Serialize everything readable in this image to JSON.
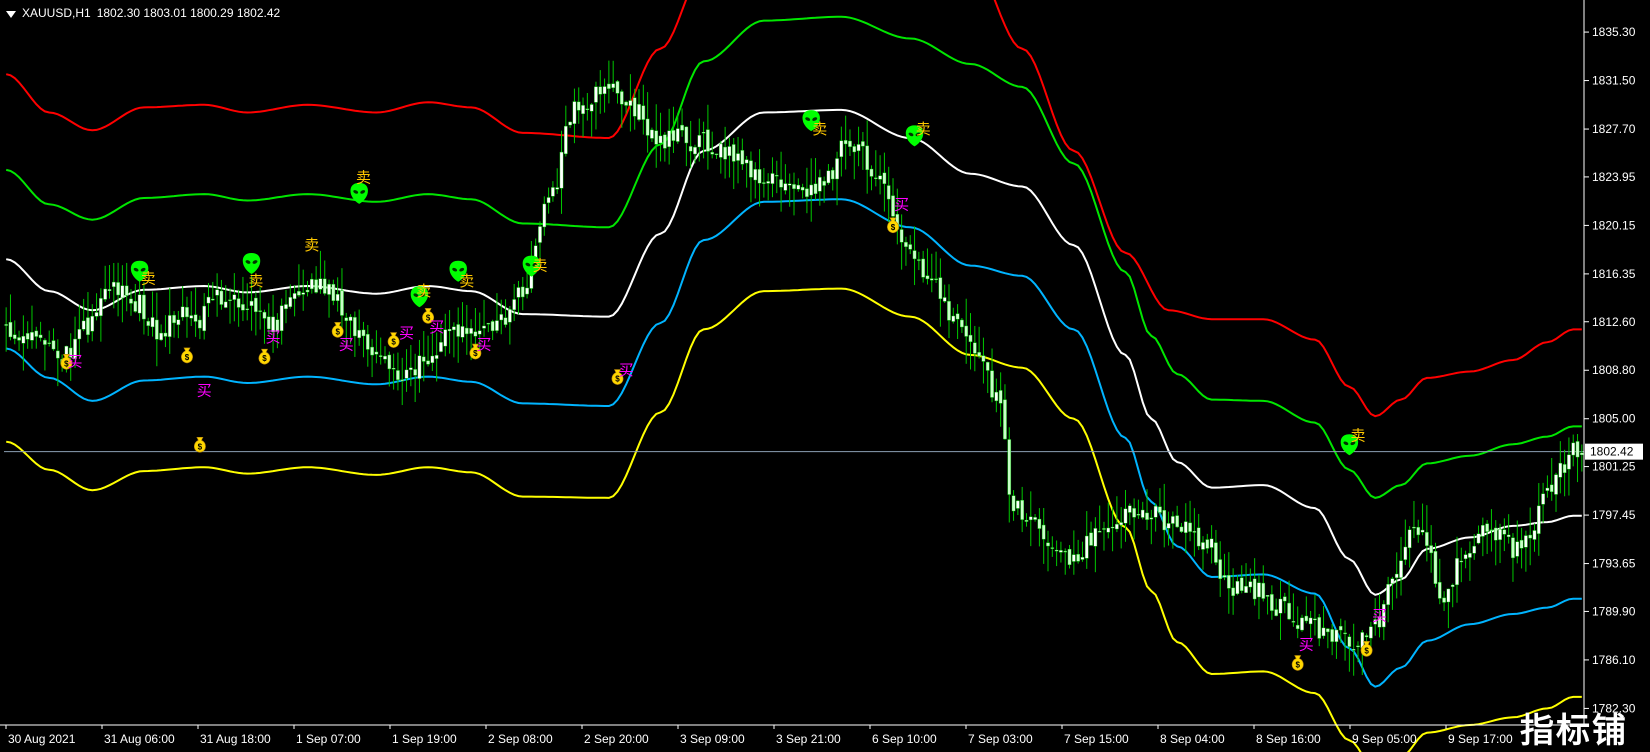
{
  "header": {
    "symbol": "XAUUSD,H1",
    "ohlc": "1802.30 1803.01 1800.29 1802.42"
  },
  "watermark": "指标铺",
  "colors": {
    "background": "#000000",
    "axis": "#ffffff",
    "bull_candle": "#ffffff",
    "bear_candle": "#c8ffc8",
    "candle_wick": "#00c800",
    "band_red": "#ff0000",
    "band_green": "#00e600",
    "band_white": "#ffffff",
    "band_blue": "#00b4ff",
    "band_yellow": "#ffff00",
    "buy_text": "#ff00ff",
    "sell_text": "#ffc800",
    "alien_icon": "#00ff00",
    "money_icon": "#ffd700",
    "price_line": "#8ca0b4"
  },
  "chart_data": {
    "type": "candlestick",
    "symbol": "XAUUSD",
    "timeframe": "H1",
    "ylim": [
      1781.0,
      1837.5
    ],
    "y_ticks": [
      "1835.30",
      "1831.50",
      "1827.70",
      "1823.95",
      "1820.15",
      "1816.35",
      "1812.60",
      "1808.80",
      "1805.00",
      "1801.25",
      "1797.45",
      "1793.65",
      "1789.90",
      "1786.10",
      "1782.30"
    ],
    "x_labels": [
      "30 Aug 2021",
      "31 Aug 06:00",
      "31 Aug 18:00",
      "1 Sep 07:00",
      "1 Sep 19:00",
      "2 Sep 08:00",
      "2 Sep 20:00",
      "3 Sep 09:00",
      "3 Sep 21:00",
      "6 Sep 10:00",
      "7 Sep 03:00",
      "7 Sep 15:00",
      "8 Sep 04:00",
      "8 Sep 16:00",
      "9 Sep 05:00",
      "9 Sep 17:00"
    ],
    "current_price": "1802.42",
    "close_anchors": [
      [
        0,
        1812.2
      ],
      [
        8,
        1811.3
      ],
      [
        14,
        1810.0
      ],
      [
        20,
        1812.5
      ],
      [
        24,
        1815.5
      ],
      [
        30,
        1814.2
      ],
      [
        36,
        1811.5
      ],
      [
        40,
        1813.0
      ],
      [
        44,
        1812.6
      ],
      [
        50,
        1814.8
      ],
      [
        56,
        1813.8
      ],
      [
        62,
        1812.2
      ],
      [
        66,
        1814.8
      ],
      [
        74,
        1815.6
      ],
      [
        80,
        1812.5
      ],
      [
        86,
        1810.4
      ],
      [
        92,
        1808.8
      ],
      [
        98,
        1809.4
      ],
      [
        104,
        1812.0
      ],
      [
        110,
        1811.8
      ],
      [
        116,
        1812.4
      ],
      [
        120,
        1815.0
      ],
      [
        126,
        1822.0
      ],
      [
        132,
        1829.0
      ],
      [
        140,
        1831.0
      ],
      [
        146,
        1829.0
      ],
      [
        152,
        1827.0
      ],
      [
        160,
        1826.8
      ],
      [
        166,
        1826.0
      ],
      [
        172,
        1824.8
      ],
      [
        178,
        1823.5
      ],
      [
        184,
        1822.6
      ],
      [
        190,
        1823.5
      ],
      [
        196,
        1826.8
      ],
      [
        202,
        1824.2
      ],
      [
        208,
        1819.5
      ],
      [
        214,
        1816.2
      ],
      [
        220,
        1812.8
      ],
      [
        226,
        1810.5
      ],
      [
        230,
        1807.0
      ],
      [
        234,
        1798.5
      ],
      [
        238,
        1797.0
      ],
      [
        244,
        1795.4
      ],
      [
        248,
        1794.2
      ],
      [
        254,
        1796.2
      ],
      [
        260,
        1797.5
      ],
      [
        266,
        1797.8
      ],
      [
        272,
        1796.5
      ],
      [
        278,
        1795.8
      ],
      [
        284,
        1792.0
      ],
      [
        290,
        1791.5
      ],
      [
        296,
        1790.2
      ],
      [
        302,
        1788.8
      ],
      [
        308,
        1788.2
      ],
      [
        314,
        1787.7
      ],
      [
        318,
        1788.6
      ],
      [
        322,
        1792.5
      ],
      [
        326,
        1796.0
      ],
      [
        330,
        1795.4
      ],
      [
        334,
        1790.5
      ],
      [
        338,
        1793.7
      ],
      [
        342,
        1795.8
      ],
      [
        346,
        1796.2
      ],
      [
        350,
        1794.8
      ],
      [
        354,
        1795.4
      ],
      [
        358,
        1799.2
      ],
      [
        364,
        1802.4
      ]
    ],
    "bands": [
      {
        "color": "red",
        "anchors": [
          [
            0,
            1832.0
          ],
          [
            10,
            1829.0
          ],
          [
            20,
            1827.6
          ],
          [
            32,
            1829.4
          ],
          [
            46,
            1829.6
          ],
          [
            56,
            1829.0
          ],
          [
            70,
            1829.6
          ],
          [
            86,
            1829.0
          ],
          [
            98,
            1829.8
          ],
          [
            108,
            1829.4
          ],
          [
            120,
            1827.4
          ],
          [
            140,
            1827.0
          ],
          [
            152,
            1834.0
          ],
          [
            162,
            1840.0
          ],
          [
            176,
            1844.0
          ],
          [
            194,
            1846.0
          ],
          [
            210,
            1845.0
          ],
          [
            224,
            1841.0
          ],
          [
            236,
            1834.0
          ],
          [
            248,
            1826.0
          ],
          [
            260,
            1818.0
          ],
          [
            270,
            1813.5
          ],
          [
            280,
            1812.8
          ],
          [
            292,
            1812.8
          ],
          [
            304,
            1811.2
          ],
          [
            312,
            1807.5
          ],
          [
            318,
            1805.2
          ],
          [
            324,
            1806.5
          ],
          [
            330,
            1808.2
          ],
          [
            340,
            1808.7
          ],
          [
            350,
            1809.6
          ],
          [
            358,
            1811.0
          ],
          [
            364,
            1812.0
          ]
        ]
      },
      {
        "color": "green",
        "anchors": [
          [
            0,
            1824.5
          ],
          [
            10,
            1821.8
          ],
          [
            20,
            1820.6
          ],
          [
            32,
            1822.3
          ],
          [
            46,
            1822.6
          ],
          [
            56,
            1822.1
          ],
          [
            70,
            1822.6
          ],
          [
            86,
            1822.0
          ],
          [
            98,
            1822.6
          ],
          [
            108,
            1822.2
          ],
          [
            120,
            1820.3
          ],
          [
            140,
            1820.0
          ],
          [
            152,
            1826.5
          ],
          [
            162,
            1833.0
          ],
          [
            176,
            1836.2
          ],
          [
            194,
            1836.5
          ],
          [
            210,
            1834.8
          ],
          [
            224,
            1832.8
          ],
          [
            236,
            1831.0
          ],
          [
            248,
            1825.0
          ],
          [
            260,
            1816.5
          ],
          [
            266,
            1811.5
          ],
          [
            272,
            1808.5
          ],
          [
            280,
            1806.5
          ],
          [
            292,
            1806.4
          ],
          [
            304,
            1804.7
          ],
          [
            312,
            1801.0
          ],
          [
            318,
            1798.8
          ],
          [
            324,
            1799.8
          ],
          [
            330,
            1801.5
          ],
          [
            340,
            1802.1
          ],
          [
            350,
            1803.0
          ],
          [
            358,
            1803.6
          ],
          [
            364,
            1804.4
          ]
        ]
      },
      {
        "color": "white",
        "anchors": [
          [
            0,
            1817.5
          ],
          [
            10,
            1815.0
          ],
          [
            20,
            1813.5
          ],
          [
            32,
            1815.1
          ],
          [
            46,
            1815.4
          ],
          [
            56,
            1814.9
          ],
          [
            70,
            1815.4
          ],
          [
            86,
            1814.8
          ],
          [
            98,
            1815.4
          ],
          [
            108,
            1815.0
          ],
          [
            120,
            1813.2
          ],
          [
            140,
            1813.0
          ],
          [
            152,
            1819.5
          ],
          [
            162,
            1826.0
          ],
          [
            176,
            1829.0
          ],
          [
            194,
            1829.2
          ],
          [
            210,
            1827.0
          ],
          [
            224,
            1824.2
          ],
          [
            236,
            1823.2
          ],
          [
            248,
            1818.6
          ],
          [
            260,
            1810.0
          ],
          [
            266,
            1805.0
          ],
          [
            272,
            1801.6
          ],
          [
            280,
            1799.6
          ],
          [
            292,
            1799.8
          ],
          [
            304,
            1798.0
          ],
          [
            312,
            1794.0
          ],
          [
            318,
            1791.2
          ],
          [
            324,
            1792.4
          ],
          [
            330,
            1794.8
          ],
          [
            340,
            1795.7
          ],
          [
            350,
            1796.6
          ],
          [
            358,
            1796.9
          ],
          [
            364,
            1797.4
          ]
        ]
      },
      {
        "color": "blue",
        "anchors": [
          [
            0,
            1810.5
          ],
          [
            10,
            1808.2
          ],
          [
            20,
            1806.4
          ],
          [
            32,
            1808.0
          ],
          [
            46,
            1808.3
          ],
          [
            56,
            1807.8
          ],
          [
            70,
            1808.3
          ],
          [
            86,
            1807.7
          ],
          [
            98,
            1808.3
          ],
          [
            108,
            1807.9
          ],
          [
            120,
            1806.2
          ],
          [
            140,
            1806.0
          ],
          [
            152,
            1812.5
          ],
          [
            162,
            1819.0
          ],
          [
            176,
            1822.0
          ],
          [
            194,
            1822.2
          ],
          [
            210,
            1820.0
          ],
          [
            224,
            1817.0
          ],
          [
            236,
            1816.2
          ],
          [
            248,
            1812.0
          ],
          [
            260,
            1803.5
          ],
          [
            266,
            1798.5
          ],
          [
            272,
            1795.0
          ],
          [
            280,
            1792.6
          ],
          [
            292,
            1792.8
          ],
          [
            304,
            1791.3
          ],
          [
            312,
            1787.0
          ],
          [
            318,
            1784.0
          ],
          [
            324,
            1785.5
          ],
          [
            330,
            1787.6
          ],
          [
            340,
            1788.9
          ],
          [
            350,
            1789.7
          ],
          [
            358,
            1790.2
          ],
          [
            364,
            1790.9
          ]
        ]
      },
      {
        "color": "yellow",
        "anchors": [
          [
            0,
            1803.2
          ],
          [
            10,
            1801.0
          ],
          [
            20,
            1799.4
          ],
          [
            32,
            1800.9
          ],
          [
            46,
            1801.2
          ],
          [
            56,
            1800.7
          ],
          [
            70,
            1801.2
          ],
          [
            86,
            1800.6
          ],
          [
            98,
            1801.2
          ],
          [
            108,
            1800.8
          ],
          [
            120,
            1798.9
          ],
          [
            140,
            1798.8
          ],
          [
            152,
            1805.5
          ],
          [
            162,
            1812.0
          ],
          [
            176,
            1815.0
          ],
          [
            194,
            1815.2
          ],
          [
            210,
            1813.0
          ],
          [
            224,
            1810.0
          ],
          [
            236,
            1809.0
          ],
          [
            248,
            1805.0
          ],
          [
            260,
            1796.5
          ],
          [
            266,
            1791.5
          ],
          [
            272,
            1787.5
          ],
          [
            280,
            1785.0
          ],
          [
            292,
            1785.2
          ],
          [
            304,
            1783.5
          ],
          [
            312,
            1779.8
          ],
          [
            318,
            1777.5
          ],
          [
            324,
            1778.5
          ],
          [
            330,
            1780.4
          ],
          [
            340,
            1781.0
          ],
          [
            350,
            1781.6
          ],
          [
            358,
            1782.3
          ],
          [
            364,
            1783.2
          ]
        ]
      }
    ],
    "markers": [
      {
        "bar": 31,
        "price": 1816.6,
        "type": "alien"
      },
      {
        "bar": 33,
        "price": 1816.0,
        "type": "sell"
      },
      {
        "bar": 57,
        "price": 1817.2,
        "type": "alien"
      },
      {
        "bar": 58,
        "price": 1815.8,
        "type": "sell"
      },
      {
        "bar": 82,
        "price": 1822.7,
        "type": "alien"
      },
      {
        "bar": 83,
        "price": 1823.9,
        "type": "sell"
      },
      {
        "bar": 71,
        "price": 1818.6,
        "type": "sell"
      },
      {
        "bar": 105,
        "price": 1816.6,
        "type": "alien"
      },
      {
        "bar": 107,
        "price": 1815.8,
        "type": "sell"
      },
      {
        "bar": 96,
        "price": 1814.6,
        "type": "alien"
      },
      {
        "bar": 97,
        "price": 1815.0,
        "type": "sell"
      },
      {
        "bar": 122,
        "price": 1817.0,
        "type": "alien"
      },
      {
        "bar": 124,
        "price": 1817.0,
        "type": "sell"
      },
      {
        "bar": 187,
        "price": 1828.4,
        "type": "alien"
      },
      {
        "bar": 189,
        "price": 1827.7,
        "type": "sell"
      },
      {
        "bar": 211,
        "price": 1827.2,
        "type": "alien"
      },
      {
        "bar": 213,
        "price": 1827.7,
        "type": "sell"
      },
      {
        "bar": 312,
        "price": 1803.0,
        "type": "alien"
      },
      {
        "bar": 314,
        "price": 1803.7,
        "type": "sell"
      },
      {
        "bar": 14,
        "price": 1809.5,
        "type": "money"
      },
      {
        "bar": 16,
        "price": 1809.5,
        "type": "buy"
      },
      {
        "bar": 42,
        "price": 1810.0,
        "type": "money"
      },
      {
        "bar": 46,
        "price": 1807.2,
        "type": "buy"
      },
      {
        "bar": 45,
        "price": 1803.0,
        "type": "money"
      },
      {
        "bar": 60,
        "price": 1809.9,
        "type": "money"
      },
      {
        "bar": 62,
        "price": 1811.4,
        "type": "buy"
      },
      {
        "bar": 77,
        "price": 1812.0,
        "type": "money"
      },
      {
        "bar": 79,
        "price": 1810.8,
        "type": "buy"
      },
      {
        "bar": 90,
        "price": 1811.2,
        "type": "money"
      },
      {
        "bar": 93,
        "price": 1811.7,
        "type": "buy"
      },
      {
        "bar": 98,
        "price": 1813.1,
        "type": "money"
      },
      {
        "bar": 100,
        "price": 1812.2,
        "type": "buy"
      },
      {
        "bar": 109,
        "price": 1810.3,
        "type": "money"
      },
      {
        "bar": 111,
        "price": 1810.8,
        "type": "buy"
      },
      {
        "bar": 142,
        "price": 1808.3,
        "type": "money"
      },
      {
        "bar": 144,
        "price": 1808.8,
        "type": "buy"
      },
      {
        "bar": 206,
        "price": 1820.2,
        "type": "money"
      },
      {
        "bar": 208,
        "price": 1821.8,
        "type": "buy"
      },
      {
        "bar": 300,
        "price": 1785.9,
        "type": "money"
      },
      {
        "bar": 302,
        "price": 1787.3,
        "type": "buy"
      },
      {
        "bar": 316,
        "price": 1787.0,
        "type": "money"
      },
      {
        "bar": 319,
        "price": 1789.6,
        "type": "buy"
      }
    ],
    "marker_labels": {
      "buy": "买",
      "sell": "卖"
    }
  }
}
